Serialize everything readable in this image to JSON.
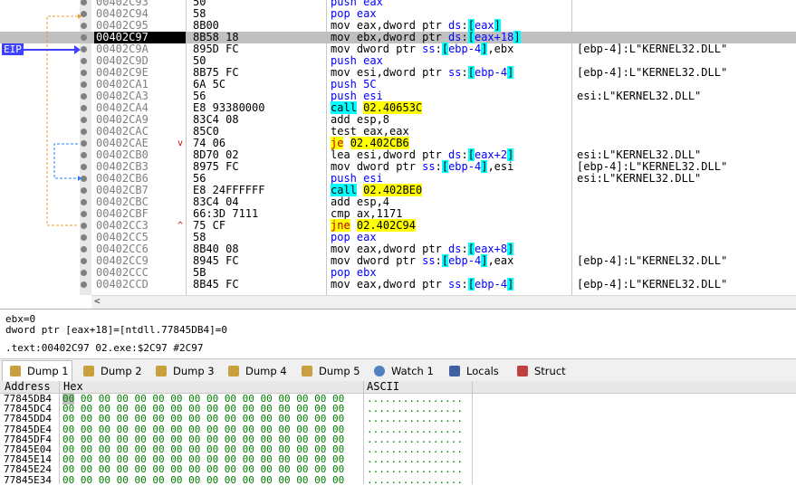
{
  "eip_label": "EIP",
  "disasm": [
    {
      "addr": "00402C93",
      "bytes": "50",
      "instr": [
        {
          "t": "push eax",
          "c": "kw-cyan"
        }
      ],
      "cmt": ""
    },
    {
      "addr": "00402C94",
      "bytes": "58",
      "instr": [
        {
          "t": "pop eax",
          "c": "kw-cyan"
        }
      ],
      "cmt": ""
    },
    {
      "addr": "00402C95",
      "bytes": "8B00",
      "instr": [
        {
          "t": "mov eax,dword ptr ds:[eax]",
          "c": ""
        }
      ],
      "cmt": ""
    },
    {
      "addr": "00402C97",
      "bytes": "8B58 18",
      "instr": [
        {
          "t": "mov ebx,dword ptr ds:[eax+18]",
          "c": ""
        }
      ],
      "cmt": "",
      "selected": true
    },
    {
      "addr": "00402C9A",
      "bytes": "895D FC",
      "instr": [
        {
          "t": "mov dword ptr ss:[ebp-4],ebx",
          "c": ""
        }
      ],
      "cmt": "[ebp-4]:L\"KERNEL32.DLL\""
    },
    {
      "addr": "00402C9D",
      "bytes": "50",
      "instr": [
        {
          "t": "push eax",
          "c": "kw-cyan"
        }
      ],
      "cmt": ""
    },
    {
      "addr": "00402C9E",
      "bytes": "8B75 FC",
      "instr": [
        {
          "t": "mov esi,dword ptr ss:[ebp-4]",
          "c": ""
        }
      ],
      "cmt": "[ebp-4]:L\"KERNEL32.DLL\""
    },
    {
      "addr": "00402CA1",
      "bytes": "6A 5C",
      "instr": [
        {
          "t": "push 5C",
          "c": "kw-cyan"
        }
      ],
      "cmt": ""
    },
    {
      "addr": "00402CA3",
      "bytes": "56",
      "instr": [
        {
          "t": "push esi",
          "c": "kw-cyan"
        }
      ],
      "cmt": "esi:L\"KERNEL32.DLL\""
    },
    {
      "addr": "00402CA4",
      "bytes": "E8 93380000",
      "instr": [
        {
          "t": "call 02.40653C",
          "c": "call"
        }
      ],
      "cmt": ""
    },
    {
      "addr": "00402CA9",
      "bytes": "83C4 08",
      "instr": [
        {
          "t": "add esp,8",
          "c": ""
        }
      ],
      "cmt": ""
    },
    {
      "addr": "00402CAC",
      "bytes": "85C0",
      "instr": [
        {
          "t": "test eax,eax",
          "c": ""
        }
      ],
      "cmt": ""
    },
    {
      "addr": "00402CAE",
      "bytes": "74 06",
      "instr": [
        {
          "t": "je 02.402CB6",
          "c": "jump"
        }
      ],
      "cmt": "",
      "arrow": "v"
    },
    {
      "addr": "00402CB0",
      "bytes": "8D70 02",
      "instr": [
        {
          "t": "lea esi,dword ptr ds:[eax+2]",
          "c": ""
        }
      ],
      "cmt": "esi:L\"KERNEL32.DLL\""
    },
    {
      "addr": "00402CB3",
      "bytes": "8975 FC",
      "instr": [
        {
          "t": "mov dword ptr ss:[ebp-4],esi",
          "c": ""
        }
      ],
      "cmt": "[ebp-4]:L\"KERNEL32.DLL\""
    },
    {
      "addr": "00402CB6",
      "bytes": "56",
      "instr": [
        {
          "t": "push esi",
          "c": "kw-cyan"
        }
      ],
      "cmt": "esi:L\"KERNEL32.DLL\""
    },
    {
      "addr": "00402CB7",
      "bytes": "E8 24FFFFFF",
      "instr": [
        {
          "t": "call 02.402BE0",
          "c": "call"
        }
      ],
      "cmt": ""
    },
    {
      "addr": "00402CBC",
      "bytes": "83C4 04",
      "instr": [
        {
          "t": "add esp,4",
          "c": ""
        }
      ],
      "cmt": ""
    },
    {
      "addr": "00402CBF",
      "bytes": "66:3D 7111",
      "instr": [
        {
          "t": "cmp ax,1171",
          "c": ""
        }
      ],
      "cmt": ""
    },
    {
      "addr": "00402CC3",
      "bytes": "75 CF",
      "instr": [
        {
          "t": "jne 02.402C94",
          "c": "jump"
        }
      ],
      "cmt": "",
      "arrow": "^"
    },
    {
      "addr": "00402CC5",
      "bytes": "58",
      "instr": [
        {
          "t": "pop eax",
          "c": "kw-cyan"
        }
      ],
      "cmt": ""
    },
    {
      "addr": "00402CC6",
      "bytes": "8B40 08",
      "instr": [
        {
          "t": "mov eax,dword ptr ds:[eax+8]",
          "c": ""
        }
      ],
      "cmt": ""
    },
    {
      "addr": "00402CC9",
      "bytes": "8945 FC",
      "instr": [
        {
          "t": "mov dword ptr ss:[ebp-4],eax",
          "c": ""
        }
      ],
      "cmt": "[ebp-4]:L\"KERNEL32.DLL\""
    },
    {
      "addr": "00402CCC",
      "bytes": "5B",
      "instr": [
        {
          "t": "pop ebx",
          "c": "kw-cyan"
        }
      ],
      "cmt": ""
    },
    {
      "addr": "00402CCD",
      "bytes": "8B45 FC",
      "instr": [
        {
          "t": "mov eax,dword ptr ss:[ebp-4]",
          "c": ""
        }
      ],
      "cmt": "[ebp-4]:L\"KERNEL32.DLL\""
    }
  ],
  "info": {
    "line1": "ebx=0",
    "line2": "dword ptr [eax+18]=[ntdll.77845DB4]=0",
    "line3": ".text:00402C97 02.exe:$2C97 #2C97"
  },
  "tabs": [
    {
      "label": "Dump 1",
      "icon": "dump-icon",
      "active": true
    },
    {
      "label": "Dump 2",
      "icon": "dump-icon"
    },
    {
      "label": "Dump 3",
      "icon": "dump-icon"
    },
    {
      "label": "Dump 4",
      "icon": "dump-icon"
    },
    {
      "label": "Dump 5",
      "icon": "dump-icon"
    },
    {
      "label": "Watch 1",
      "icon": "watch-icon"
    },
    {
      "label": "Locals",
      "icon": "locals-icon"
    },
    {
      "label": "Struct",
      "icon": "struct-icon"
    }
  ],
  "dump": {
    "headers": {
      "address": "Address",
      "hex": "Hex",
      "ascii": "ASCII"
    },
    "rows": [
      {
        "addr": "77845DB4",
        "hex": "00 00 00 00 00 00 00 00 00 00 00 00 00 00 00 00",
        "ascii": "................"
      },
      {
        "addr": "77845DC4",
        "hex": "00 00 00 00 00 00 00 00 00 00 00 00 00 00 00 00",
        "ascii": "................"
      },
      {
        "addr": "77845DD4",
        "hex": "00 00 00 00 00 00 00 00 00 00 00 00 00 00 00 00",
        "ascii": "................"
      },
      {
        "addr": "77845DE4",
        "hex": "00 00 00 00 00 00 00 00 00 00 00 00 00 00 00 00",
        "ascii": "................"
      },
      {
        "addr": "77845DF4",
        "hex": "00 00 00 00 00 00 00 00 00 00 00 00 00 00 00 00",
        "ascii": "................"
      },
      {
        "addr": "77845E04",
        "hex": "00 00 00 00 00 00 00 00 00 00 00 00 00 00 00 00",
        "ascii": "................"
      },
      {
        "addr": "77845E14",
        "hex": "00 00 00 00 00 00 00 00 00 00 00 00 00 00 00 00",
        "ascii": "................"
      },
      {
        "addr": "77845E24",
        "hex": "00 00 00 00 00 00 00 00 00 00 00 00 00 00 00 00",
        "ascii": "................"
      },
      {
        "addr": "77845E34",
        "hex": "00 00 00 00 00 00 00 00 00 00 00 00 00 00 00 00",
        "ascii": "................"
      }
    ]
  }
}
